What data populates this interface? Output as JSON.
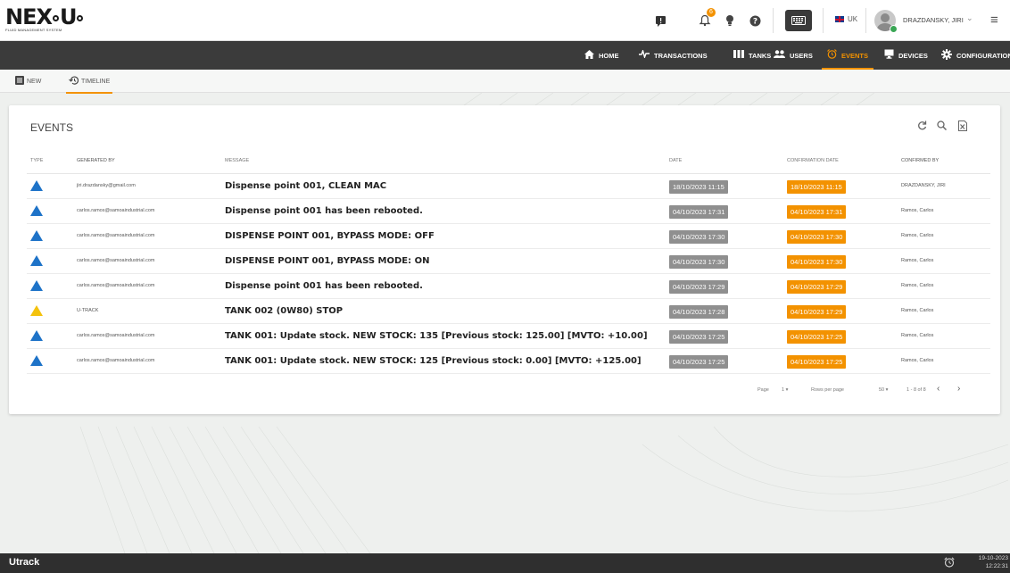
{
  "app": {
    "logo": "NEX U",
    "logo_sub": "FLUID MANAGEMENT SYSTEM",
    "language": "UK",
    "user": "DRAZDANSKY, JIRI",
    "notification_count": "6"
  },
  "nav": {
    "items": [
      {
        "label": "HOME",
        "icon": "home-icon"
      },
      {
        "label": "TRANSACTIONS",
        "icon": "pulse-icon"
      },
      {
        "label": "TANKS",
        "icon": "tanks-icon"
      },
      {
        "label": "USERS",
        "icon": "users-icon"
      },
      {
        "label": "EVENTS",
        "icon": "alarm-clock-icon"
      },
      {
        "label": "DEVICES",
        "icon": "monitor-icon"
      },
      {
        "label": "CONFIGURATION",
        "icon": "gear-icon"
      }
    ],
    "active": "EVENTS",
    "active_color": "#f39200"
  },
  "tabs": [
    {
      "label": "NEW",
      "icon": "list-icon"
    },
    {
      "label": "TIMELINE",
      "icon": "history-icon"
    }
  ],
  "events": {
    "title": "EVENTS",
    "columns": [
      "TYPE",
      "GENERATED BY",
      "MESSAGE",
      "DATE",
      "CONFIRMATION DATE",
      "CONFIRMED BY"
    ],
    "rows": [
      {
        "type": "info",
        "generated_by": "jiri.drazdansky@gmail.com",
        "message": "Dispense point 001, CLEAN MAC",
        "date": "18/10/2023 11:15",
        "confirmation_date": "18/10/2023 11:15",
        "confirmed_by": "DRAZDANSKY, JIRI"
      },
      {
        "type": "info",
        "generated_by": "carlos.ramos@samoaindustrial.com",
        "message": "Dispense point 001 has been rebooted.",
        "date": "04/10/2023 17:31",
        "confirmation_date": "04/10/2023 17:31",
        "confirmed_by": "Ramos, Carlos"
      },
      {
        "type": "info",
        "generated_by": "carlos.ramos@samoaindustrial.com",
        "message": "DISPENSE POINT 001, BYPASS MODE: OFF",
        "date": "04/10/2023 17:30",
        "confirmation_date": "04/10/2023 17:30",
        "confirmed_by": "Ramos, Carlos"
      },
      {
        "type": "info",
        "generated_by": "carlos.ramos@samoaindustrial.com",
        "message": "DISPENSE POINT 001, BYPASS MODE: ON",
        "date": "04/10/2023 17:30",
        "confirmation_date": "04/10/2023 17:30",
        "confirmed_by": "Ramos, Carlos"
      },
      {
        "type": "info",
        "generated_by": "carlos.ramos@samoaindustrial.com",
        "message": "Dispense point 001 has been rebooted.",
        "date": "04/10/2023 17:29",
        "confirmation_date": "04/10/2023 17:29",
        "confirmed_by": "Ramos, Carlos"
      },
      {
        "type": "warning",
        "generated_by": "U-TRACK",
        "message": "TANK 002 (0W80) STOP",
        "date": "04/10/2023 17:28",
        "confirmation_date": "04/10/2023 17:29",
        "confirmed_by": "Ramos, Carlos"
      },
      {
        "type": "info",
        "generated_by": "carlos.ramos@samoaindustrial.com",
        "message": "TANK 001: Update stock. NEW STOCK: 135 [Previous stock: 125.00] [MVTO: +10.00]",
        "date": "04/10/2023 17:25",
        "confirmation_date": "04/10/2023 17:25",
        "confirmed_by": "Ramos, Carlos"
      },
      {
        "type": "info",
        "generated_by": "carlos.ramos@samoaindustrial.com",
        "message": "TANK 001: Update stock. NEW STOCK: 125 [Previous stock: 0.00] [MVTO: +125.00]",
        "date": "04/10/2023 17:25",
        "confirmation_date": "04/10/2023 17:25",
        "confirmed_by": "Ramos, Carlos"
      }
    ],
    "pager": {
      "page_label": "Page",
      "page_value": "1",
      "rows_label": "Rows per page",
      "rows_value": "50",
      "range": "1 - 8 of 8"
    }
  },
  "footer": {
    "brand": "Utrack",
    "date": "19-10-2023",
    "time": "12:22:31"
  }
}
